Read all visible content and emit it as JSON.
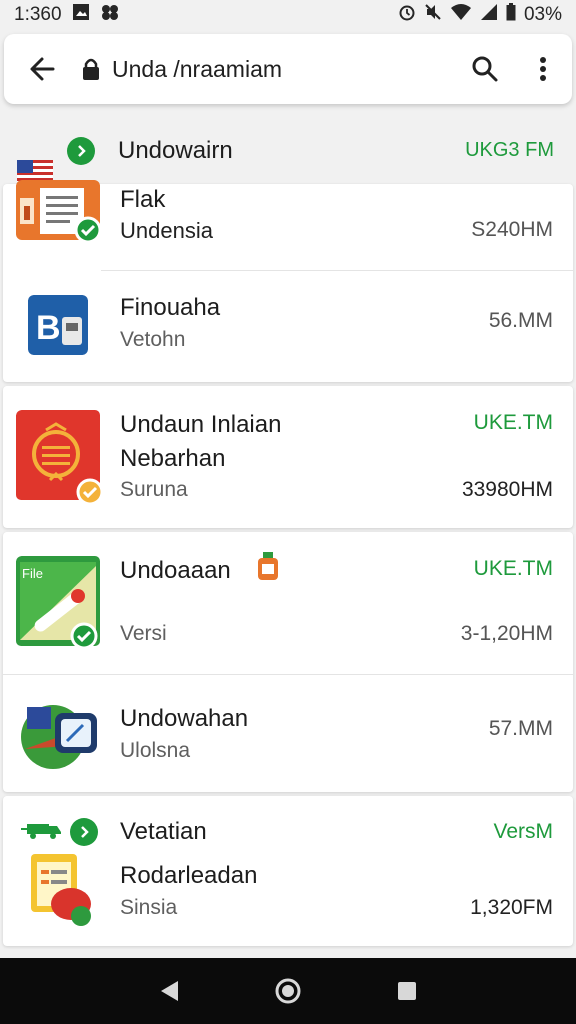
{
  "status_bar": {
    "time": "1:360",
    "battery": "03%",
    "icons": [
      "image-icon",
      "notification-icon",
      "alarm-icon",
      "mute-icon",
      "wifi-icon",
      "signal-icon",
      "battery-icon"
    ]
  },
  "app_bar": {
    "title": "Unda /nraamiam",
    "icons": [
      "back-arrow-icon",
      "lock-icon",
      "search-icon",
      "more-vert-icon"
    ]
  },
  "section": {
    "title": "Undowairn",
    "right": "UKG3 FM"
  },
  "items": [
    {
      "title": "Flak",
      "subtitle": "Undensia",
      "size": "S240HM",
      "icon": "document-app-icon"
    },
    {
      "title": "Finouaha",
      "subtitle": "Vetohn",
      "size": "56.MM",
      "icon": "bt-app-icon"
    },
    {
      "title": "Undaun Inlaian",
      "title2": "Nebarhan",
      "subtitle": "Suruna",
      "tag": "UKE.TM",
      "size": "33980HM",
      "icon": "red-app-icon"
    },
    {
      "title": "Undoaaan",
      "subtitle": "Versi",
      "tag": "UKE.TM",
      "size": "3-1,20HM",
      "icon": "green-pen-app-icon"
    },
    {
      "title": "Undowahan",
      "subtitle": "Ulolsna",
      "size": "57.MM",
      "icon": "map-app-icon"
    },
    {
      "title": "Vetatian",
      "title2": "Rodarleadan",
      "subtitle": "Sinsia",
      "tag": "VersM",
      "size": "1,320FM",
      "icon": "notes-app-icon"
    }
  ],
  "nav_bar": {
    "icons": [
      "back-triangle-icon",
      "home-circle-icon",
      "recents-square-icon"
    ]
  },
  "colors": {
    "accent_green": "#1e9a3c",
    "background": "#f1f1f1",
    "card": "#ffffff",
    "navbar": "#0b0b0b"
  }
}
